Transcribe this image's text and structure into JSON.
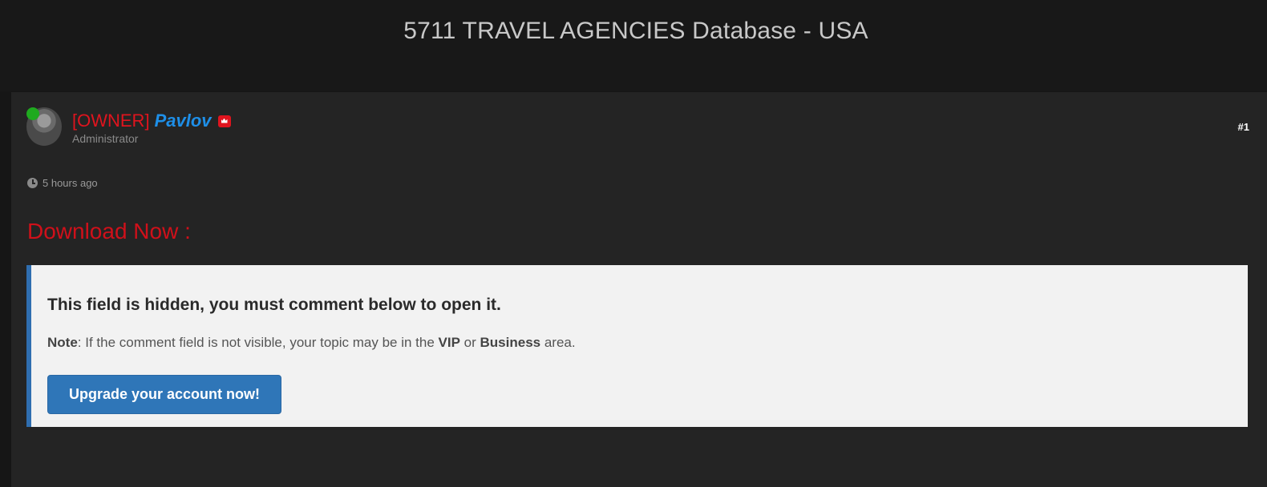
{
  "page": {
    "title": "5711 TRAVEL AGENCIES Database - USA"
  },
  "post": {
    "author": {
      "tag": "[OWNER]",
      "name": "Pavlov",
      "role": "Administrator"
    },
    "number": "#1",
    "time": "5 hours ago",
    "download_heading": "Download Now :",
    "hidden_box": {
      "title": "This field is hidden, you must comment below to open it.",
      "note_label": "Note",
      "note_text_1": ": If the comment field is not visible, your topic may be in the ",
      "note_vip": "VIP",
      "note_or": " or ",
      "note_business": "Business",
      "note_end": " area.",
      "button_label": "Upgrade your account now!"
    },
    "colors": {
      "owner_tag": "#e0141e",
      "username": "#1e8fe8",
      "download_heading": "#d0101a",
      "button": "#2f76b8",
      "online": "#1faa1f"
    }
  }
}
